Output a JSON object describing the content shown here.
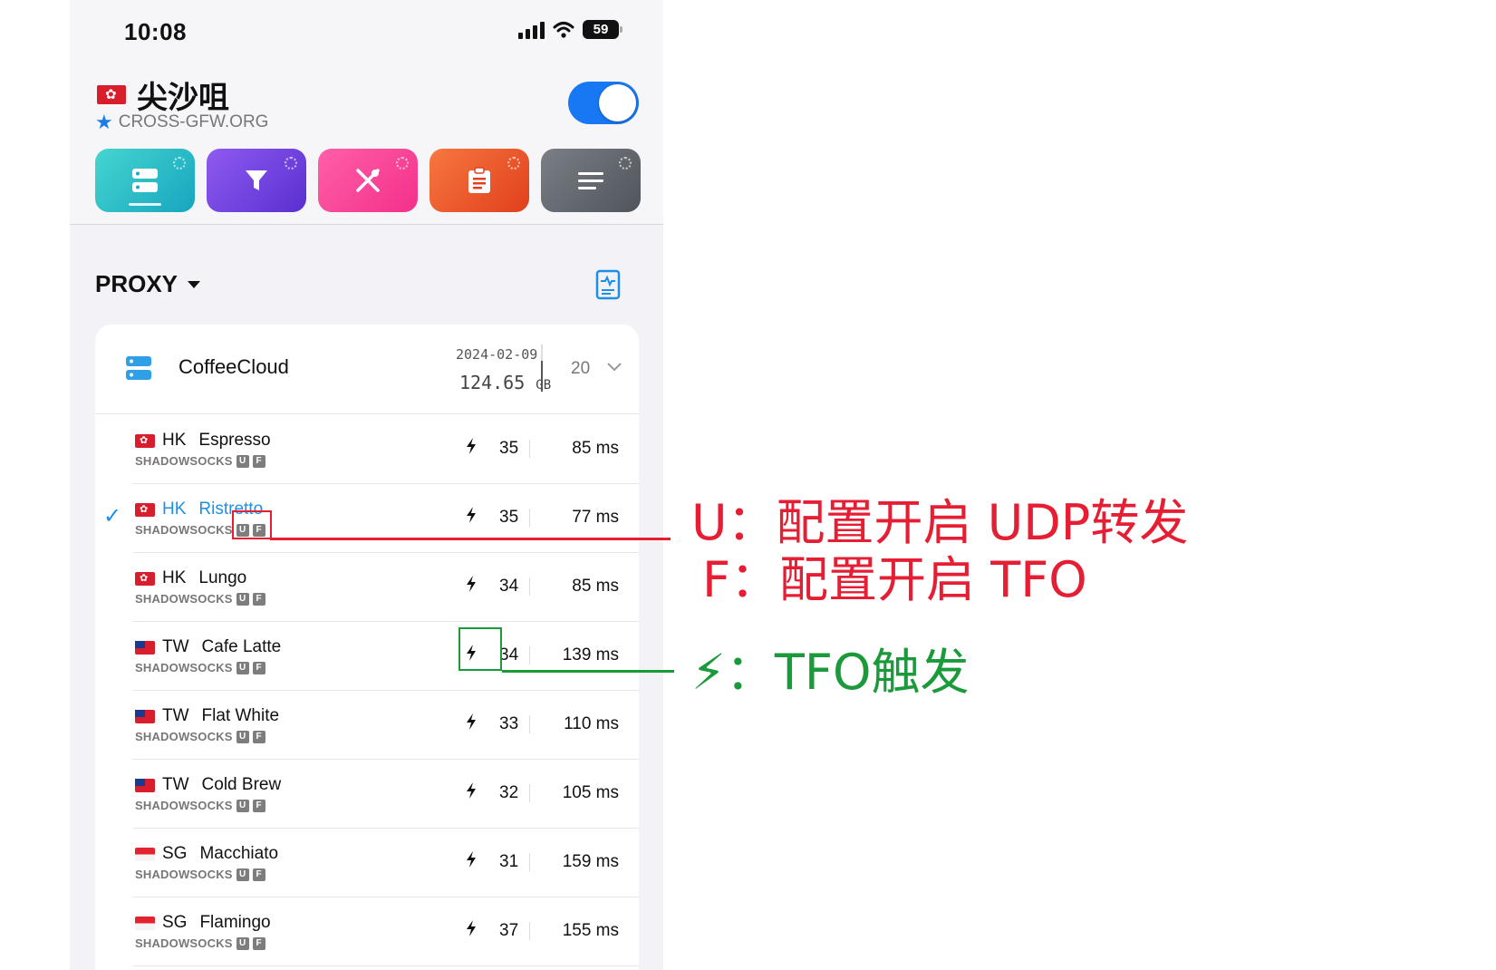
{
  "status_bar": {
    "time": "10:08",
    "battery": "59"
  },
  "header": {
    "location_name": "尖沙咀",
    "subtitle": "CROSS-GFW.ORG",
    "toggle_on": true
  },
  "toolbar": {
    "tiles": [
      "servers-icon",
      "filter-icon",
      "tools-icon",
      "clipboard-icon",
      "menu-icon"
    ]
  },
  "section": {
    "title": "PROXY"
  },
  "subscription": {
    "name": "CoffeeCloud",
    "date": "2024-02-09",
    "size": "124.65",
    "size_unit": "GB",
    "count": "20"
  },
  "rows": [
    {
      "flag": "hk",
      "code": "HK",
      "name": "Espresso",
      "protocol": "SHADOWSOCKS",
      "u": "U",
      "f": "F",
      "score": "35",
      "latency": "85 ms",
      "selected": false
    },
    {
      "flag": "hk",
      "code": "HK",
      "name": "Ristretto",
      "protocol": "SHADOWSOCKS",
      "u": "U",
      "f": "F",
      "score": "35",
      "latency": "77 ms",
      "selected": true
    },
    {
      "flag": "hk",
      "code": "HK",
      "name": "Lungo",
      "protocol": "SHADOWSOCKS",
      "u": "U",
      "f": "F",
      "score": "34",
      "latency": "85 ms",
      "selected": false
    },
    {
      "flag": "tw",
      "code": "TW",
      "name": "Cafe Latte",
      "protocol": "SHADOWSOCKS",
      "u": "U",
      "f": "F",
      "score": "34",
      "latency": "139 ms",
      "selected": false
    },
    {
      "flag": "tw",
      "code": "TW",
      "name": "Flat White",
      "protocol": "SHADOWSOCKS",
      "u": "U",
      "f": "F",
      "score": "33",
      "latency": "110 ms",
      "selected": false
    },
    {
      "flag": "tw",
      "code": "TW",
      "name": "Cold Brew",
      "protocol": "SHADOWSOCKS",
      "u": "U",
      "f": "F",
      "score": "32",
      "latency": "105 ms",
      "selected": false
    },
    {
      "flag": "sg",
      "code": "SG",
      "name": "Macchiato",
      "protocol": "SHADOWSOCKS",
      "u": "U",
      "f": "F",
      "score": "31",
      "latency": "159 ms",
      "selected": false
    },
    {
      "flag": "sg",
      "code": "SG",
      "name": "Flamingo",
      "protocol": "SHADOWSOCKS",
      "u": "U",
      "f": "F",
      "score": "37",
      "latency": "155 ms",
      "selected": false
    }
  ],
  "annotations": {
    "u_note": "U：配置开启 UDP转发",
    "f_note": "F：配置开启 TFO",
    "tfo_note": "⚡：TFO触发"
  },
  "colors": {
    "accent": "#1877f2",
    "annotation_red": "#e61e33",
    "annotation_green": "#1a9a3a"
  }
}
